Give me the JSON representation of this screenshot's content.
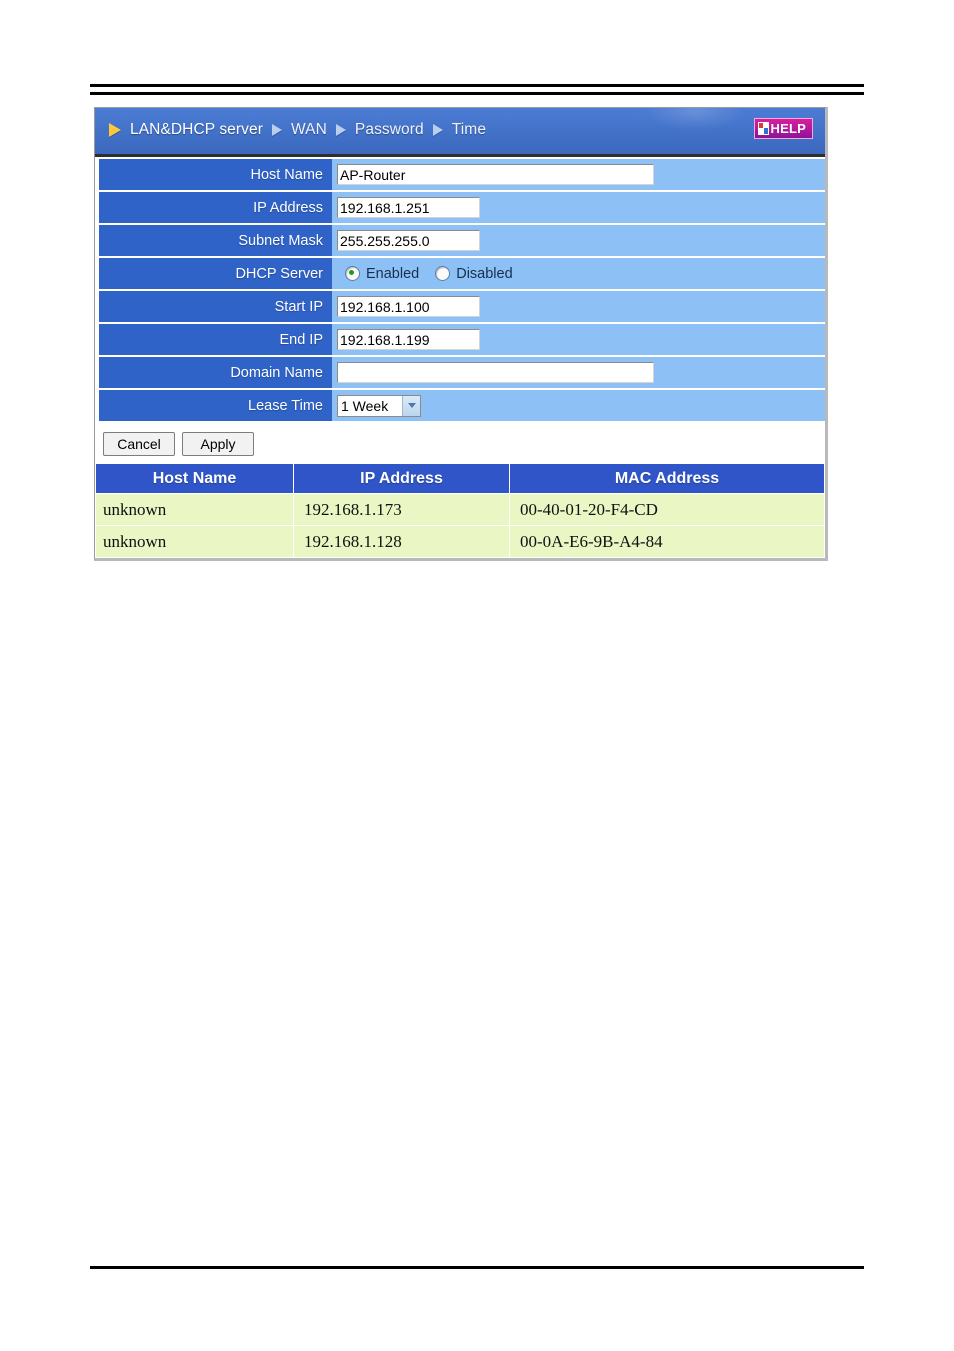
{
  "nav": {
    "items": [
      {
        "label": "LAN&DHCP server",
        "active": true,
        "arrow": "gold-triangle-icon"
      },
      {
        "label": "WAN",
        "active": false,
        "arrow": "triangle-icon"
      },
      {
        "label": "Password",
        "active": false,
        "arrow": "triangle-icon"
      },
      {
        "label": "Time",
        "active": false,
        "arrow": "triangle-icon"
      }
    ],
    "help_label": "HELP",
    "help_icon": "help-icon"
  },
  "form": {
    "host_name": {
      "label": "Host Name",
      "value": "AP-Router",
      "placeholder": ""
    },
    "ip_address": {
      "label": "IP Address",
      "value": "192.168.1.251",
      "placeholder": ""
    },
    "subnet_mask": {
      "label": "Subnet Mask",
      "value": "255.255.255.0",
      "placeholder": ""
    },
    "dhcp_server": {
      "label": "DHCP Server",
      "enabled_label": "Enabled",
      "disabled_label": "Disabled",
      "selected": "Enabled"
    },
    "start_ip": {
      "label": "Start IP",
      "value": "192.168.1.100",
      "placeholder": ""
    },
    "end_ip": {
      "label": "End IP",
      "value": "192.168.1.199",
      "placeholder": ""
    },
    "domain_name": {
      "label": "Domain Name",
      "value": "",
      "placeholder": ""
    },
    "lease_time": {
      "label": "Lease Time",
      "value": "1 Week"
    }
  },
  "actions": {
    "cancel_label": "Cancel",
    "apply_label": "Apply"
  },
  "client_table": {
    "headers": [
      "Host Name",
      "IP Address",
      "MAC Address"
    ],
    "rows": [
      [
        "unknown",
        "192.168.1.173",
        "00-40-01-20-F4-CD"
      ],
      [
        "unknown",
        "192.168.1.128",
        "00-0A-E6-9B-A4-84"
      ]
    ]
  },
  "colors": {
    "nav_blue": "#4271c8",
    "label_blue": "#2f63c8",
    "value_blue": "#8dc0f5",
    "table_header_blue": "#2f55c8",
    "table_row_green": "#eaf7c4",
    "help_magenta": "#b5189f",
    "radio_on_green": "#1f9b22",
    "active_arrow_gold": "#ffc83c"
  }
}
